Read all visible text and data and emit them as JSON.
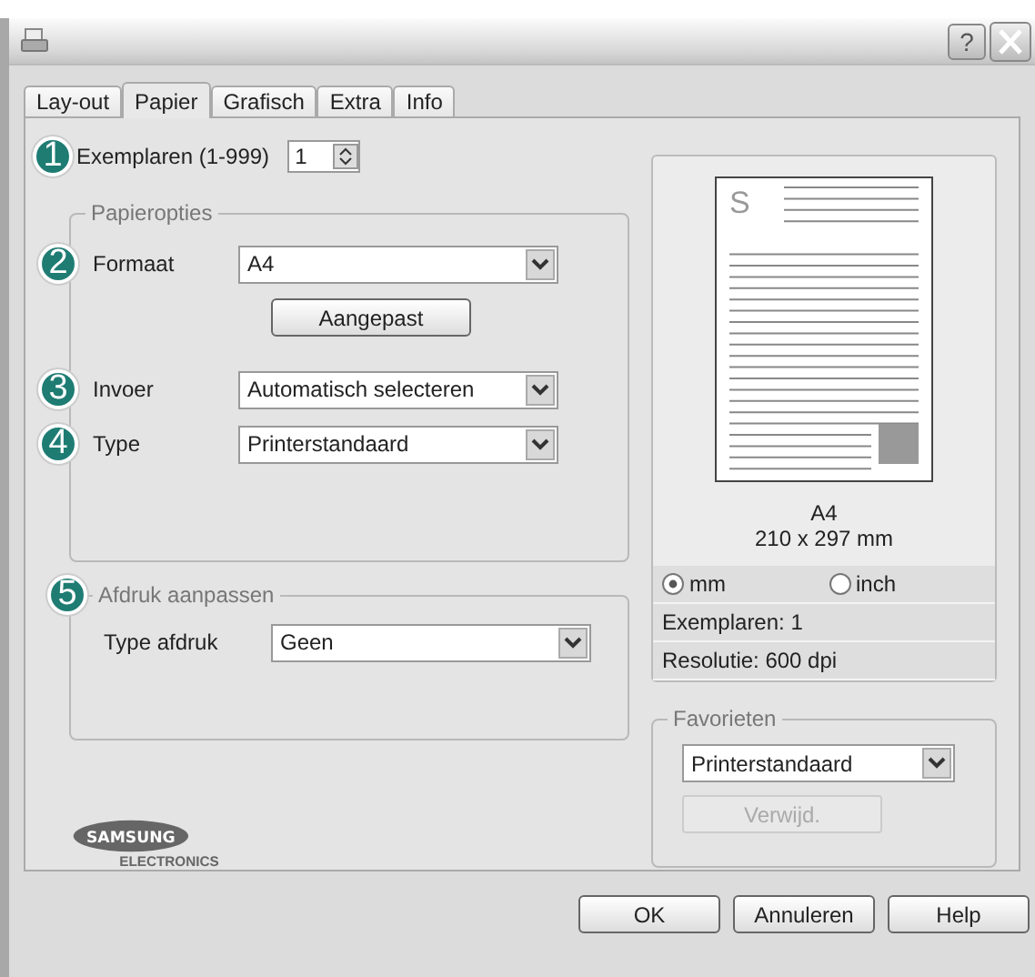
{
  "window": {
    "help_button": "?"
  },
  "tabs": [
    {
      "label": "Lay-out",
      "selected": false
    },
    {
      "label": "Papier",
      "selected": true
    },
    {
      "label": "Grafisch",
      "selected": false
    },
    {
      "label": "Extra",
      "selected": false
    },
    {
      "label": "Info",
      "selected": false
    }
  ],
  "copies": {
    "callout": "1",
    "label": "Exemplaren (1-999)",
    "value": "1"
  },
  "paper_options": {
    "title": "Papieropties",
    "rows": [
      {
        "kind": "select",
        "callout": "2",
        "label": "Formaat",
        "value": "A4"
      },
      {
        "kind": "button",
        "label": "Aangepast"
      },
      {
        "kind": "select",
        "callout": "3",
        "label": "Invoer",
        "value": "Automatisch selecteren"
      },
      {
        "kind": "select",
        "callout": "4",
        "label": "Type",
        "value": "Printerstandaard"
      }
    ]
  },
  "print_adjust": {
    "callout": "5",
    "title": "Afdruk aanpassen",
    "label": "Type afdruk",
    "value": "Geen"
  },
  "logo": {
    "brand": "SAMSUNG",
    "sub": "ELECTRONICS"
  },
  "preview": {
    "page_letter": "S",
    "size": "A4",
    "dimensions": "210 x 297 mm",
    "units": [
      {
        "label": "mm",
        "selected": true
      },
      {
        "label": "inch",
        "selected": false
      }
    ],
    "copies": "Exemplaren: 1",
    "resolution": "Resolutie: 600 dpi"
  },
  "favorites": {
    "title": "Favorieten",
    "value": "Printerstandaard",
    "delete_button": {
      "label": "Verwijd.",
      "disabled": true
    }
  },
  "buttons": [
    "OK",
    "Annuleren",
    "Help"
  ]
}
